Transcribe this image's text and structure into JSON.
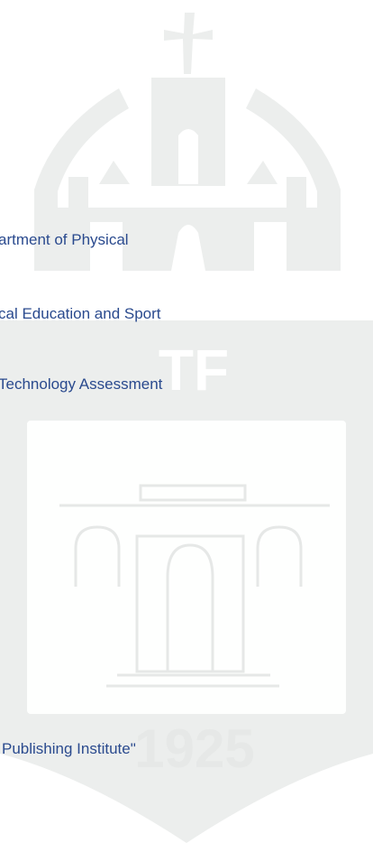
{
  "colors": {
    "link": "#2a4a8e",
    "watermark": "#eceeed"
  },
  "watermark": {
    "icon": "faculty-crest-watermark",
    "letters": "TF",
    "year": "1925"
  },
  "links": [
    {
      "text": "artment of Physical"
    },
    {
      "text": "cal Education and Sport"
    },
    {
      "text": "Technology Assessment"
    },
    {
      "text": "Publishing Institute\""
    }
  ]
}
